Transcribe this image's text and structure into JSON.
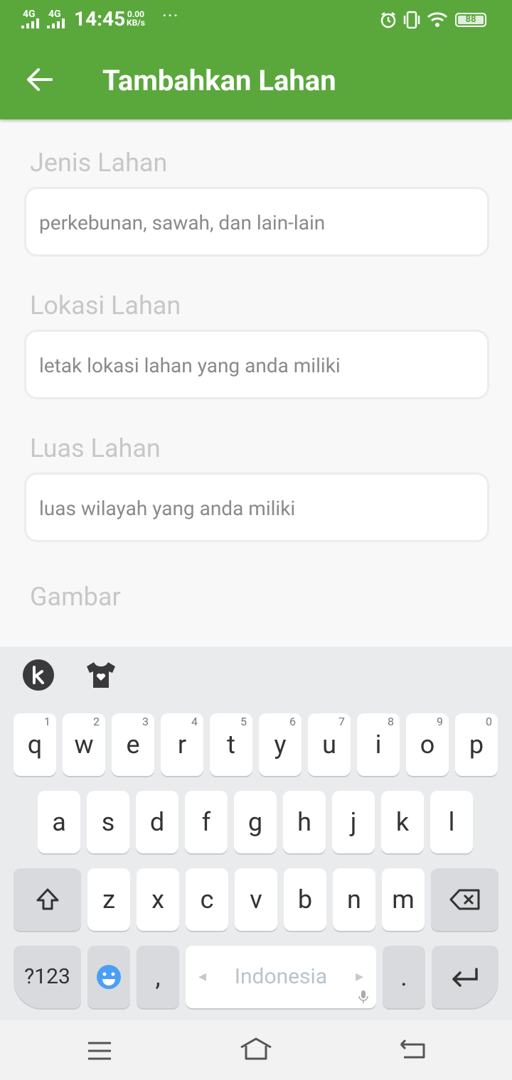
{
  "status": {
    "signal1": "4G",
    "signal2": "4G",
    "time": "14:45",
    "speed_value": "0.00",
    "speed_unit": "KB/s",
    "more": "···",
    "battery": "88"
  },
  "header": {
    "title": "Tambahkan Lahan"
  },
  "form": {
    "jenis": {
      "label": "Jenis Lahan",
      "placeholder": "perkebunan, sawah, dan lain-lain"
    },
    "lokasi": {
      "label": "Lokasi Lahan",
      "placeholder": "letak lokasi lahan yang anda miliki"
    },
    "luas": {
      "label": "Luas Lahan",
      "placeholder": "luas wilayah yang anda miliki"
    },
    "gambar": {
      "label": "Gambar"
    }
  },
  "keyboard": {
    "row1": [
      {
        "k": "q",
        "n": "1"
      },
      {
        "k": "w",
        "n": "2"
      },
      {
        "k": "e",
        "n": "3"
      },
      {
        "k": "r",
        "n": "4"
      },
      {
        "k": "t",
        "n": "5"
      },
      {
        "k": "y",
        "n": "6"
      },
      {
        "k": "u",
        "n": "7"
      },
      {
        "k": "i",
        "n": "8"
      },
      {
        "k": "o",
        "n": "9"
      },
      {
        "k": "p",
        "n": "0"
      }
    ],
    "row2": [
      "a",
      "s",
      "d",
      "f",
      "g",
      "h",
      "j",
      "k",
      "l"
    ],
    "row3": [
      "z",
      "x",
      "c",
      "v",
      "b",
      "n",
      "m"
    ],
    "symbols": "?123",
    "comma": ",",
    "space": "Indonesia",
    "period": "."
  }
}
